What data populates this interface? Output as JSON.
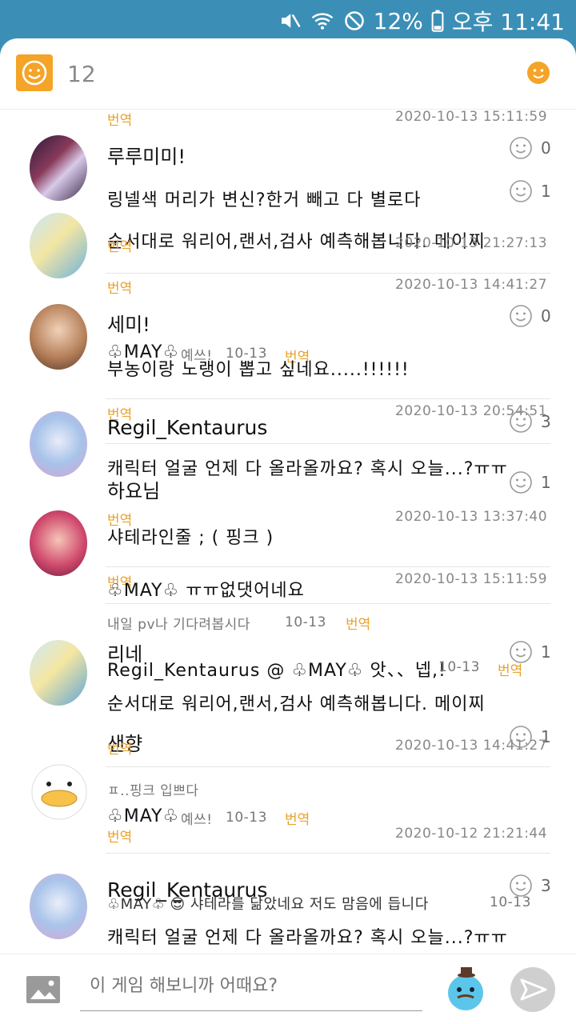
{
  "status": {
    "battery": "12%",
    "time": "오후 11:41"
  },
  "header": {
    "count": "12"
  },
  "comments": [
    {
      "translate": "번역",
      "time": "2020-10-13 15:11:59",
      "name": "루루미미!",
      "likes": "0"
    },
    {
      "text": "링넬색 머리가 변신?한거 빼고 다 별로다",
      "likes": "1"
    },
    {
      "text": "순서대로 워리어,랜서,검사 예측해봅니다. 메이찌",
      "translate": "번역",
      "time": "2020-10-13 21:27:13"
    },
    {
      "translate": "번역",
      "time": "2020-10-13 14:41:27",
      "name": "세미!",
      "likes": "0"
    },
    {
      "reply_name": "♧MAY♧",
      "reply_text": "예쓰!",
      "reply_date": "10-13",
      "reply_translate": "번역",
      "text": "부농이랑 노랭이 뽑고 싶네요.....!!!!!!"
    },
    {
      "translate": "번역",
      "time": "2020-10-13 20:54:51",
      "name": "Regil_Kentaurus",
      "likes": "3"
    },
    {
      "text": "캐릭터 얼굴 언제 다 올라올까요? 혹시 오늘...?ㅠㅠ",
      "likes": "1"
    },
    {
      "name": "하요님",
      "translate": "번역",
      "time": "2020-10-13 13:37:40",
      "text": "샤테라인줄 ; ( 핑크 )"
    },
    {
      "translate": "번역",
      "text": "♧MAY♧ ㅠㅠ없댓어네요",
      "time": "2020-10-13 15:11:59"
    },
    {
      "text": "내일 pv나 기다려봅시다",
      "date": "10-13",
      "translate": "번역"
    },
    {
      "name": "리네",
      "likes": "1",
      "reply": "Regil_Kentaurus @ ♧MAY♧ 앗、、넵,!",
      "reply_date": "10-13",
      "reply_translate": "번역"
    },
    {
      "text": "순서대로 워리어,랜서,검사 예측해봅니다. 메이찌"
    },
    {
      "name": "샌향",
      "likes": "1",
      "translate": "번역",
      "time": "2020-10-13 14:41:27"
    },
    {
      "text": "ㅍ..핑크 입쁘다"
    },
    {
      "reply_name": "♧MAY♧",
      "reply_text": "예쓰!",
      "reply_date": "10-13",
      "reply_translate": "번역"
    },
    {
      "translate": "번역",
      "time": "2020-10-12 21:21:44"
    },
    {
      "name": "Regil_Kentaurus",
      "likes": "3",
      "reply": "♧MAY♧ 😎 샤테라를 닮았네요 저도 맘음에 듭니다",
      "reply_date": "10-13"
    },
    {
      "text": "캐릭터 얼굴 언제 다 올라올까요? 혹시 오늘...?ㅠㅠ"
    }
  ],
  "input": {
    "placeholder": "이 게임 해보니까 어때요?"
  },
  "colors": {
    "accent": "#f4a428",
    "statusbar": "#3b8fb6",
    "translate": "#e8a22c"
  }
}
